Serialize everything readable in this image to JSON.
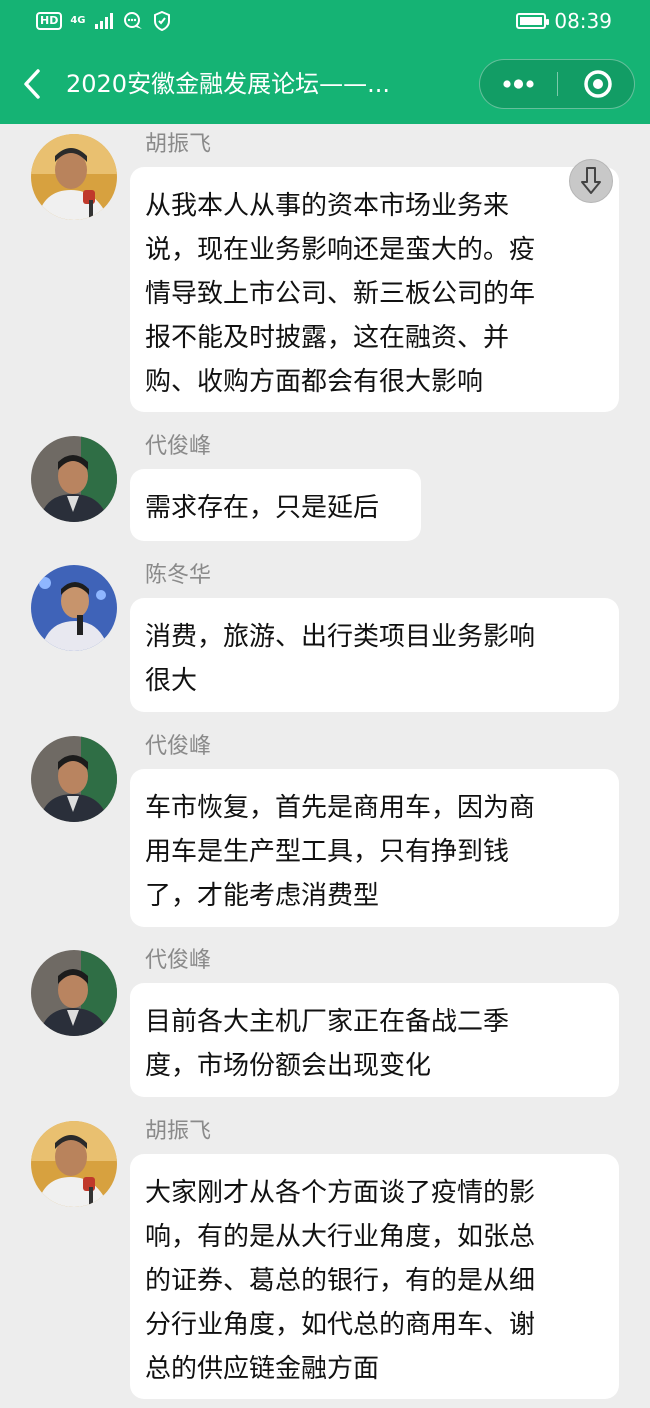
{
  "status_bar": {
    "hd_label": "HD",
    "network_label": "4G",
    "time": "08:39"
  },
  "nav": {
    "title": "2020安徽金融发展论坛——..."
  },
  "messages": [
    {
      "sender": "胡振飞",
      "text": "从我本人从事的资本市场业务来\n说，现在业务影响还是蛮大的。疫\n情导致上市公司、新三板公司的年\n报不能及时披露，这在融资、并\n购、收购方面都会有很大影响"
    },
    {
      "sender": "代俊峰",
      "text": "需求存在，只是延后"
    },
    {
      "sender": "陈冬华",
      "text": "消费，旅游、出行类项目业务影响\n很大"
    },
    {
      "sender": "代俊峰",
      "text": "车市恢复，首先是商用车，因为商\n用车是生产型工具，只有挣到钱\n了，才能考虑消费型"
    },
    {
      "sender": "代俊峰",
      "text": "目前各大主机厂家正在备战二季\n度，市场份额会出现变化"
    },
    {
      "sender": "胡振飞",
      "text": "大家刚才从各个方面谈了疫情的影\n响，有的是从大行业角度，如张总\n的证券、葛总的银行，有的是从细\n分行业角度，如代总的商用车、谢\n总的供应链金融方面"
    }
  ],
  "colors": {
    "header_green": "#15b374",
    "chat_background": "#ededed",
    "bubble": "#ffffff",
    "sender_name": "#8a8a8a"
  }
}
